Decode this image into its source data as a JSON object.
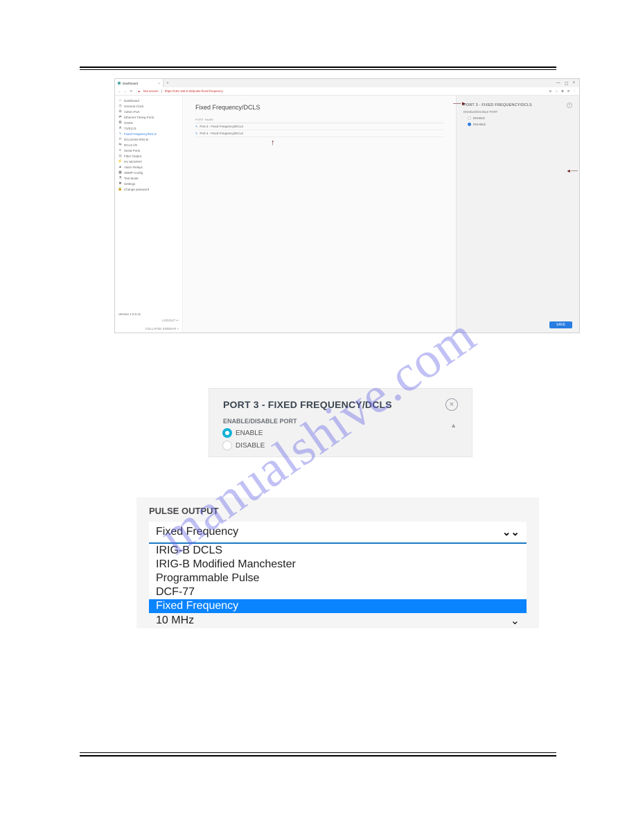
{
  "watermark": "manualshive.com",
  "browser": {
    "tab_title": "Dashboard",
    "nav": {
      "back": "←",
      "fwd": "→",
      "reload": "⟳"
    },
    "security_label": "Not secure",
    "url": "https://192.168.0.60/pulse-fixed-frequency",
    "win": {
      "min": "—",
      "max": "▢",
      "close": "×"
    },
    "actions": {
      "search": "⊕",
      "star": "☆",
      "ext": "⧉",
      "user": "⚙",
      "menu": "⋮"
    }
  },
  "sidebar": {
    "items": [
      {
        "icon": "⌂",
        "label": "Dashboard"
      },
      {
        "icon": "◷",
        "label": "General Clock"
      },
      {
        "icon": "⚙",
        "label": "Admin Port"
      },
      {
        "icon": "⇄",
        "label": "Ethernet Timing Ports"
      },
      {
        "icon": "✪",
        "label": "GNSS"
      },
      {
        "icon": "A",
        "label": "T1/E1/J1"
      },
      {
        "icon": "∿",
        "label": "Fixed Frequency/DCLS"
      },
      {
        "icon": "⊓",
        "label": "DCLS/AM IRIG-B"
      },
      {
        "icon": "⇆",
        "label": "DCLS I/O"
      },
      {
        "icon": "≡",
        "label": "Serial Ports"
      },
      {
        "icon": "◎",
        "label": "Fiber Output"
      },
      {
        "icon": "⚡",
        "label": "HV MOSFET"
      },
      {
        "icon": "▲",
        "label": "Alarm Relays"
      },
      {
        "icon": "▦",
        "label": "SNMP Config"
      },
      {
        "icon": "⚗",
        "label": "Test Mode"
      },
      {
        "icon": "✖",
        "label": "Settings"
      },
      {
        "icon": "🔒",
        "label": "Change password"
      }
    ],
    "version": "Version 1.0.0.11",
    "logout": "LOGOUT",
    "collapse": "COLLAPSE SIDEBAR"
  },
  "main": {
    "title": "Fixed Frequency/DCLS",
    "table_header": "PORT NAME",
    "rows": [
      "Port 3 - Fixed Frequency/DCLS",
      "Port 4 - Fixed Frequency/DCLS"
    ]
  },
  "panel": {
    "title": "PORT 3 - FIXED FREQUENCY/DCLS",
    "section": "ENABLE/DISABLE PORT",
    "enable": "ENABLE",
    "disable": "DISABLE",
    "save": "SAVE",
    "close": "×"
  },
  "fig2": {
    "title": "PORT 3 - FIXED FREQUENCY/DCLS",
    "section": "ENABLE/DISABLE PORT",
    "enable": "ENABLE",
    "disable": "DISABLE",
    "close": "×"
  },
  "fig3": {
    "label": "PULSE OUTPUT",
    "selected": "Fixed Frequency",
    "options": [
      "IRIG-B DCLS",
      "IRIG-B Modified Manchester",
      "Programmable Pulse",
      "DCF-77",
      "Fixed Frequency"
    ],
    "cutoff_hint": "10 MHz"
  }
}
